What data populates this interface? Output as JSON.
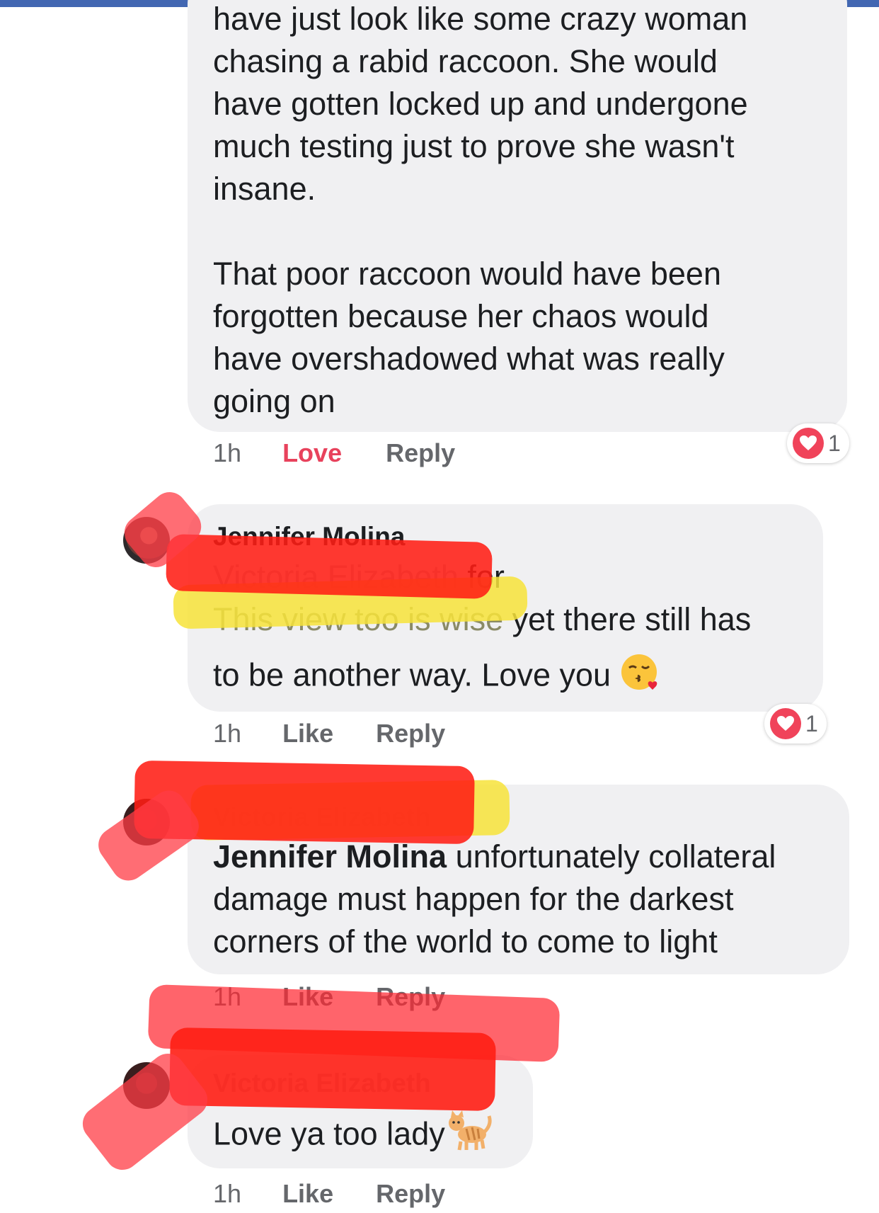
{
  "comments": [
    {
      "text_lines": [
        "have just look like some crazy woman",
        "chasing a rabid raccoon. She would",
        "have gotten locked up and undergone",
        "much testing just to prove she wasn't",
        "insane.",
        "",
        "That poor raccoon would have been",
        "forgotten because her chaos would",
        "have overshadowed what was really",
        "going on"
      ],
      "time": "1h",
      "like_label": "Love",
      "reply_label": "Reply",
      "reaction_icon": "heart-icon",
      "reaction_count": "1"
    },
    {
      "author": "Jennifer Molina",
      "mention": "Victoria Elizabeth",
      "line1_rest": "for",
      "line2_highlight": "This view too is wise",
      "line2_rest": "yet there still has",
      "line3": "to be another way. Love you",
      "emoji": "kissing-face-emoji",
      "time": "1h",
      "like_label": "Like",
      "reply_label": "Reply",
      "reaction_icon": "heart-icon",
      "reaction_count": "1"
    },
    {
      "author": "Victoria Elizabeth",
      "mention": "Jennifer Molina",
      "line1_rest": "unfortunately collateral",
      "line2": "damage must happen for the darkest",
      "line3": "corners of the world to come to light",
      "time": "1h",
      "like_label": "Like",
      "reply_label": "Reply"
    },
    {
      "author": "Victoria Elizabeth",
      "text": "Love ya too lady",
      "emoji": "cat-emoji",
      "time": "1h",
      "like_label": "Like",
      "reply_label": "Reply"
    }
  ],
  "colors": {
    "top_bar": "#4267b2",
    "bubble": "#f0f0f2",
    "love_active": "#e8425c",
    "meta_gray": "#65676b",
    "redaction_red": "#ff2a1a",
    "highlight_yellow": "#f7e33a"
  }
}
